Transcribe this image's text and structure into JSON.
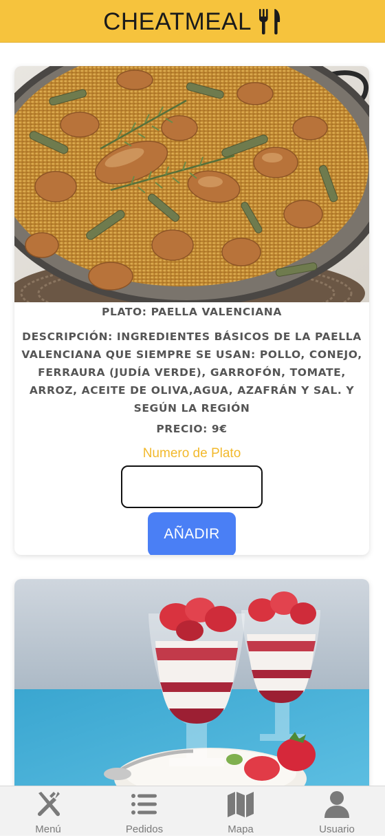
{
  "header": {
    "title": "CHEATMEAL",
    "icon": "fork-knife-icon"
  },
  "dishes": [
    {
      "image": "paella-photo",
      "name": "PLATO: PAELLA VALENCIANA",
      "description": "DESCRIPCIÓN: INGREDIENTES BÁSICOS DE LA PAELLA VALENCIANA QUE SIEMPRE SE USAN: POLLO, CONEJO, FERRAURA (JUDÍA VERDE), GARROFÓN, TOMATE, ARROZ, ACEITE DE OLIVA,AGUA, AZAFRÁN Y SAL. Y SEGÚN LA REGIÓN",
      "price": "PRECIO: 9€",
      "qty_label": "Numero de Plato",
      "qty_value": "",
      "add_label": "AÑADIR"
    },
    {
      "image": "strawberry-dessert-photo"
    }
  ],
  "tabbar": {
    "items": [
      {
        "label": "Menú",
        "icon": "fork-knife-cross-icon"
      },
      {
        "label": "Pedidos",
        "icon": "list-icon"
      },
      {
        "label": "Mapa",
        "icon": "map-icon"
      },
      {
        "label": "Usuario",
        "icon": "user-icon"
      }
    ]
  },
  "colors": {
    "header": "#f6c33d",
    "accent_button": "#4a7ff5",
    "qty_label": "#f2b92c",
    "tab_icon": "#7a7a7a"
  }
}
